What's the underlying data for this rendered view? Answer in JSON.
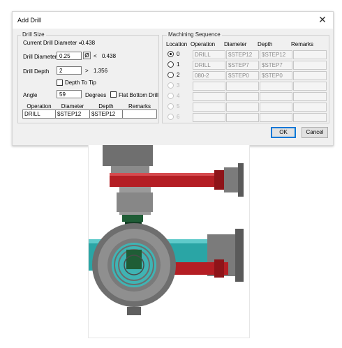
{
  "dialog": {
    "title": "Add Drill",
    "close_glyph": "✕",
    "drill_size": {
      "caption": "Drill Size",
      "current_label": "Current Drill Diameter =",
      "current_value": "0.438",
      "diameter_label": "Drill Diameter",
      "diameter_value": "0.25",
      "diameter_btn": "Ø",
      "diameter_cmp": "<",
      "diameter_ref": "0.438",
      "depth_label": "Drill Depth",
      "depth_value": "2",
      "depth_cmp": ">",
      "depth_ref": "1.356",
      "depth_to_tip": "Depth To Tip",
      "angle_label": "Angle",
      "angle_value": "59",
      "degrees": "Degrees",
      "flat_bottom": "Flat Bottom Drill",
      "op_headers": [
        "Operation",
        "Diameter",
        "Depth",
        "Remarks"
      ],
      "op_row": [
        "DRILL",
        "$STEP12",
        "$STEP12",
        ""
      ]
    },
    "machining": {
      "caption": "Machining Sequence",
      "headers": [
        "Location",
        "Operation",
        "Diameter",
        "Depth",
        "Remarks"
      ],
      "rows": [
        {
          "loc": "0",
          "op": "DRILL",
          "dia": "$STEP12",
          "depth": "$STEP12",
          "remarks": "",
          "selected": true,
          "enabled": true
        },
        {
          "loc": "1",
          "op": "DRILL",
          "dia": "$STEP7",
          "depth": "$STEP7",
          "remarks": "",
          "selected": false,
          "enabled": true
        },
        {
          "loc": "2",
          "op": "080-2",
          "dia": "$STEP0",
          "depth": "$STEP0",
          "remarks": "",
          "selected": false,
          "enabled": true
        },
        {
          "loc": "3",
          "op": "",
          "dia": "",
          "depth": "",
          "remarks": "",
          "selected": false,
          "enabled": false
        },
        {
          "loc": "4",
          "op": "",
          "dia": "",
          "depth": "",
          "remarks": "",
          "selected": false,
          "enabled": false
        },
        {
          "loc": "5",
          "op": "",
          "dia": "",
          "depth": "",
          "remarks": "",
          "selected": false,
          "enabled": false
        },
        {
          "loc": "6",
          "op": "",
          "dia": "",
          "depth": "",
          "remarks": "",
          "selected": false,
          "enabled": false
        }
      ]
    },
    "ok_label": "OK",
    "cancel_label": "Cancel"
  },
  "colors": {
    "accent": "#0078d7",
    "red_pipe": "#b41e24",
    "teal": "#2aa5a5",
    "gray_body": "#7d7d7d",
    "green_tip": "#1f5d36"
  }
}
